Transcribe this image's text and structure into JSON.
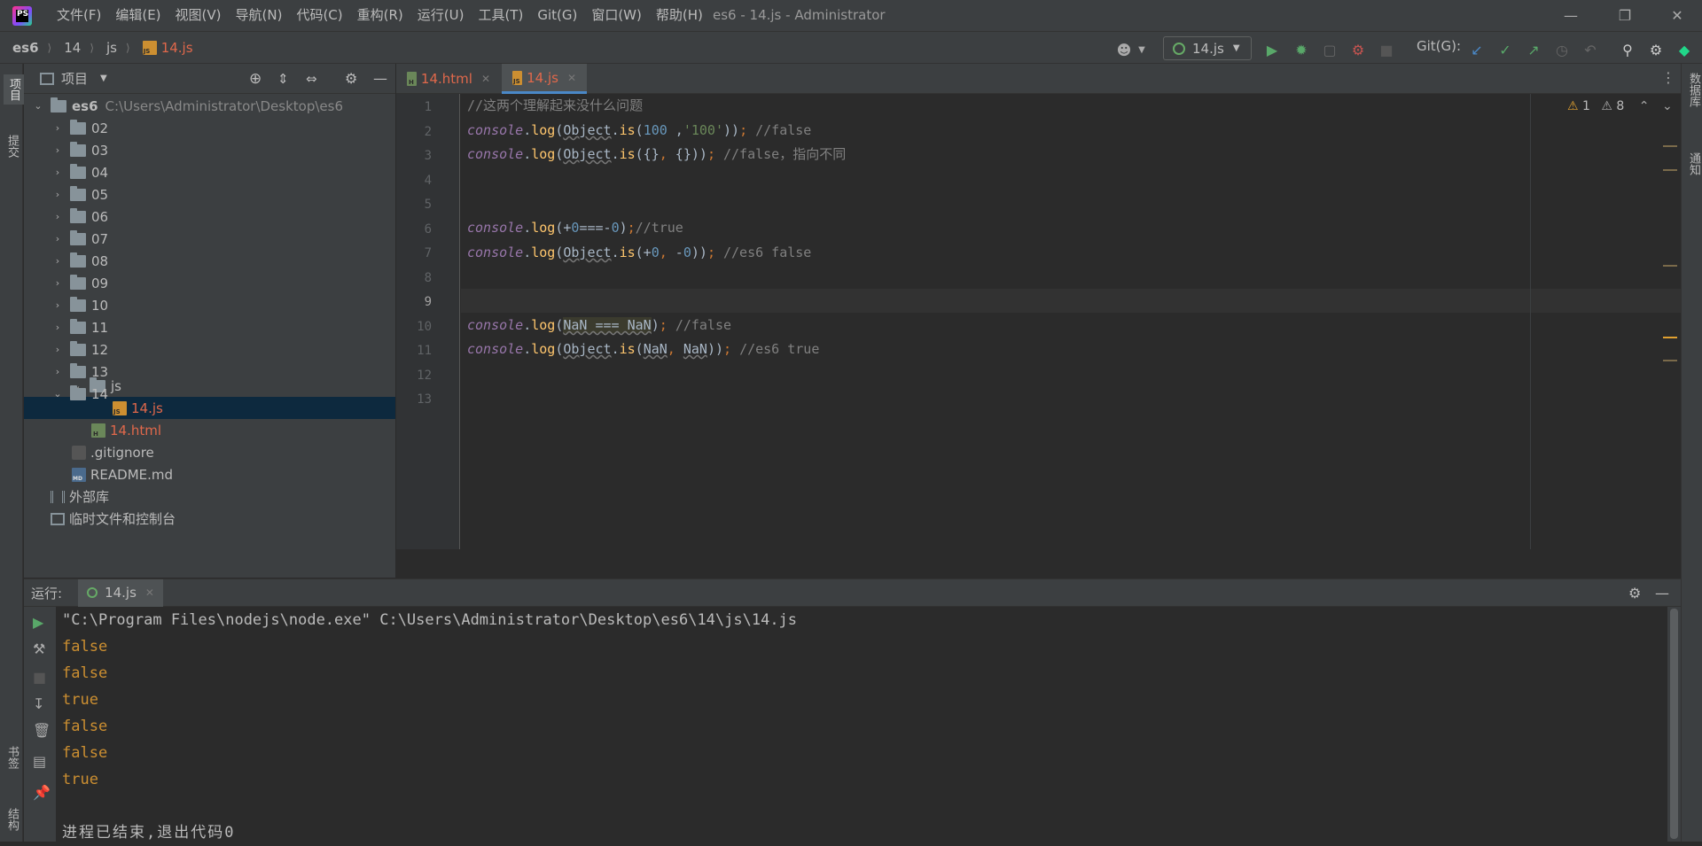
{
  "window": {
    "title": "es6 - 14.js - Administrator",
    "app_logo_text": "PS",
    "menu": [
      "文件(F)",
      "编辑(E)",
      "视图(V)",
      "导航(N)",
      "代码(C)",
      "重构(R)",
      "运行(U)",
      "工具(T)",
      "Git(G)",
      "窗口(W)",
      "帮助(H)"
    ]
  },
  "breadcrumb": [
    "es6",
    "14",
    "js",
    "14.js"
  ],
  "toolbar": {
    "run_config": "14.js",
    "git_label": "Git(G):"
  },
  "left_strip": {
    "project_tab": "项目",
    "commit_tab": "提交",
    "bookmarks_tab": "书签",
    "structure_tab": "结构"
  },
  "right_strip": {
    "database_tab": "数据库",
    "notifications_tab": "通知"
  },
  "project": {
    "header": "项目",
    "root_name": "es6",
    "root_path": "C:\\Users\\Administrator\\Desktop\\es6",
    "folders": [
      "02",
      "03",
      "04",
      "05",
      "06",
      "07",
      "08",
      "09",
      "10",
      "11",
      "12",
      "13",
      "14"
    ],
    "subfolder": "js",
    "selected_file": "14.js",
    "html_file": "14.html",
    "gitignore": ".gitignore",
    "readme": "README.md",
    "external_libs": "外部库",
    "scratches": "临时文件和控制台"
  },
  "tabs": [
    {
      "label": "14.html",
      "active": false
    },
    {
      "label": "14.js",
      "active": true
    }
  ],
  "inspections": {
    "errors": "1",
    "warnings": "8"
  },
  "code": {
    "line_numbers": [
      "1",
      "2",
      "3",
      "4",
      "5",
      "6",
      "7",
      "8",
      "9",
      "10",
      "11",
      "12",
      "13"
    ],
    "l1_comment": "//这两个理解起来没什么问题",
    "l2_val": "100",
    "l2_str": "'100'",
    "l2_comment": "//false",
    "l3_comment": "//false，指向不同",
    "l6_comment": "//true",
    "l7_comment": "//es6 false",
    "l10_comment": "//false",
    "l11_comment": "//es6 true",
    "console": "console",
    "log": "log",
    "object": "Object",
    "is": "is",
    "nan": "NaN"
  },
  "run": {
    "label": "运行:",
    "tab": "14.js",
    "command": "\"C:\\Program Files\\nodejs\\node.exe\" C:\\Users\\Administrator\\Desktop\\es6\\14\\js\\14.js",
    "output": [
      "false",
      "false",
      "true",
      "false",
      "false",
      "true"
    ],
    "exit_message": "进程已结束,退出代码0"
  },
  "colors": {
    "accent": "#4a88c7",
    "output_text": "#cc8f31",
    "selected_file": "#e0684b"
  }
}
